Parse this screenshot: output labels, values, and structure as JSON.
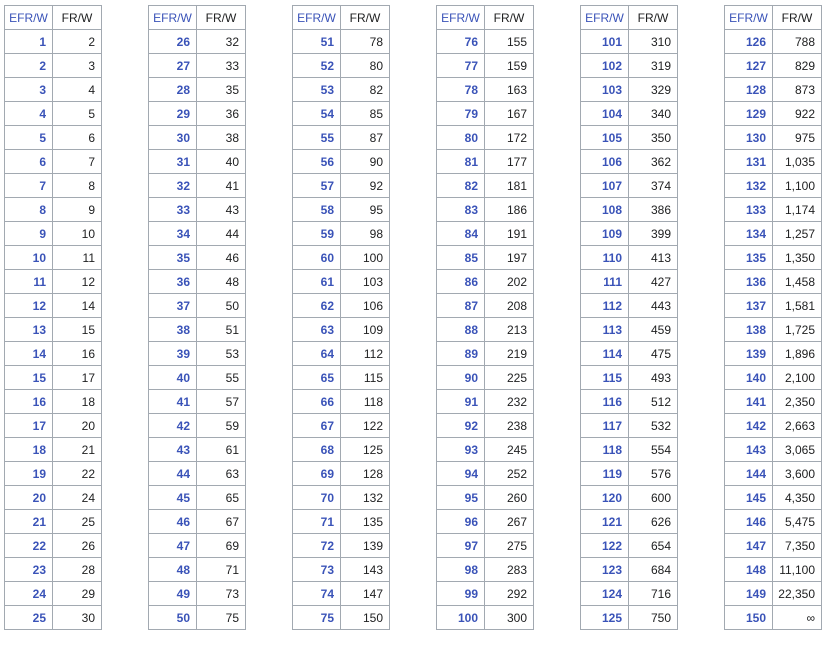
{
  "headers": {
    "efr": "EFR/W",
    "fr": "FR/W"
  },
  "tables": [
    {
      "rows": [
        [
          "1",
          "2"
        ],
        [
          "2",
          "3"
        ],
        [
          "3",
          "4"
        ],
        [
          "4",
          "5"
        ],
        [
          "5",
          "6"
        ],
        [
          "6",
          "7"
        ],
        [
          "7",
          "8"
        ],
        [
          "8",
          "9"
        ],
        [
          "9",
          "10"
        ],
        [
          "10",
          "11"
        ],
        [
          "11",
          "12"
        ],
        [
          "12",
          "14"
        ],
        [
          "13",
          "15"
        ],
        [
          "14",
          "16"
        ],
        [
          "15",
          "17"
        ],
        [
          "16",
          "18"
        ],
        [
          "17",
          "20"
        ],
        [
          "18",
          "21"
        ],
        [
          "19",
          "22"
        ],
        [
          "20",
          "24"
        ],
        [
          "21",
          "25"
        ],
        [
          "22",
          "26"
        ],
        [
          "23",
          "28"
        ],
        [
          "24",
          "29"
        ],
        [
          "25",
          "30"
        ]
      ]
    },
    {
      "rows": [
        [
          "26",
          "32"
        ],
        [
          "27",
          "33"
        ],
        [
          "28",
          "35"
        ],
        [
          "29",
          "36"
        ],
        [
          "30",
          "38"
        ],
        [
          "31",
          "40"
        ],
        [
          "32",
          "41"
        ],
        [
          "33",
          "43"
        ],
        [
          "34",
          "44"
        ],
        [
          "35",
          "46"
        ],
        [
          "36",
          "48"
        ],
        [
          "37",
          "50"
        ],
        [
          "38",
          "51"
        ],
        [
          "39",
          "53"
        ],
        [
          "40",
          "55"
        ],
        [
          "41",
          "57"
        ],
        [
          "42",
          "59"
        ],
        [
          "43",
          "61"
        ],
        [
          "44",
          "63"
        ],
        [
          "45",
          "65"
        ],
        [
          "46",
          "67"
        ],
        [
          "47",
          "69"
        ],
        [
          "48",
          "71"
        ],
        [
          "49",
          "73"
        ],
        [
          "50",
          "75"
        ]
      ]
    },
    {
      "rows": [
        [
          "51",
          "78"
        ],
        [
          "52",
          "80"
        ],
        [
          "53",
          "82"
        ],
        [
          "54",
          "85"
        ],
        [
          "55",
          "87"
        ],
        [
          "56",
          "90"
        ],
        [
          "57",
          "92"
        ],
        [
          "58",
          "95"
        ],
        [
          "59",
          "98"
        ],
        [
          "60",
          "100"
        ],
        [
          "61",
          "103"
        ],
        [
          "62",
          "106"
        ],
        [
          "63",
          "109"
        ],
        [
          "64",
          "112"
        ],
        [
          "65",
          "115"
        ],
        [
          "66",
          "118"
        ],
        [
          "67",
          "122"
        ],
        [
          "68",
          "125"
        ],
        [
          "69",
          "128"
        ],
        [
          "70",
          "132"
        ],
        [
          "71",
          "135"
        ],
        [
          "72",
          "139"
        ],
        [
          "73",
          "143"
        ],
        [
          "74",
          "147"
        ],
        [
          "75",
          "150"
        ]
      ]
    },
    {
      "rows": [
        [
          "76",
          "155"
        ],
        [
          "77",
          "159"
        ],
        [
          "78",
          "163"
        ],
        [
          "79",
          "167"
        ],
        [
          "80",
          "172"
        ],
        [
          "81",
          "177"
        ],
        [
          "82",
          "181"
        ],
        [
          "83",
          "186"
        ],
        [
          "84",
          "191"
        ],
        [
          "85",
          "197"
        ],
        [
          "86",
          "202"
        ],
        [
          "87",
          "208"
        ],
        [
          "88",
          "213"
        ],
        [
          "89",
          "219"
        ],
        [
          "90",
          "225"
        ],
        [
          "91",
          "232"
        ],
        [
          "92",
          "238"
        ],
        [
          "93",
          "245"
        ],
        [
          "94",
          "252"
        ],
        [
          "95",
          "260"
        ],
        [
          "96",
          "267"
        ],
        [
          "97",
          "275"
        ],
        [
          "98",
          "283"
        ],
        [
          "99",
          "292"
        ],
        [
          "100",
          "300"
        ]
      ]
    },
    {
      "rows": [
        [
          "101",
          "310"
        ],
        [
          "102",
          "319"
        ],
        [
          "103",
          "329"
        ],
        [
          "104",
          "340"
        ],
        [
          "105",
          "350"
        ],
        [
          "106",
          "362"
        ],
        [
          "107",
          "374"
        ],
        [
          "108",
          "386"
        ],
        [
          "109",
          "399"
        ],
        [
          "110",
          "413"
        ],
        [
          "111",
          "427"
        ],
        [
          "112",
          "443"
        ],
        [
          "113",
          "459"
        ],
        [
          "114",
          "475"
        ],
        [
          "115",
          "493"
        ],
        [
          "116",
          "512"
        ],
        [
          "117",
          "532"
        ],
        [
          "118",
          "554"
        ],
        [
          "119",
          "576"
        ],
        [
          "120",
          "600"
        ],
        [
          "121",
          "626"
        ],
        [
          "122",
          "654"
        ],
        [
          "123",
          "684"
        ],
        [
          "124",
          "716"
        ],
        [
          "125",
          "750"
        ]
      ]
    },
    {
      "rows": [
        [
          "126",
          "788"
        ],
        [
          "127",
          "829"
        ],
        [
          "128",
          "873"
        ],
        [
          "129",
          "922"
        ],
        [
          "130",
          "975"
        ],
        [
          "131",
          "1,035"
        ],
        [
          "132",
          "1,100"
        ],
        [
          "133",
          "1,174"
        ],
        [
          "134",
          "1,257"
        ],
        [
          "135",
          "1,350"
        ],
        [
          "136",
          "1,458"
        ],
        [
          "137",
          "1,581"
        ],
        [
          "138",
          "1,725"
        ],
        [
          "139",
          "1,896"
        ],
        [
          "140",
          "2,100"
        ],
        [
          "141",
          "2,350"
        ],
        [
          "142",
          "2,663"
        ],
        [
          "143",
          "3,065"
        ],
        [
          "144",
          "3,600"
        ],
        [
          "145",
          "4,350"
        ],
        [
          "146",
          "5,475"
        ],
        [
          "147",
          "7,350"
        ],
        [
          "148",
          "11,100"
        ],
        [
          "149",
          "22,350"
        ],
        [
          "150",
          "∞"
        ]
      ]
    }
  ]
}
